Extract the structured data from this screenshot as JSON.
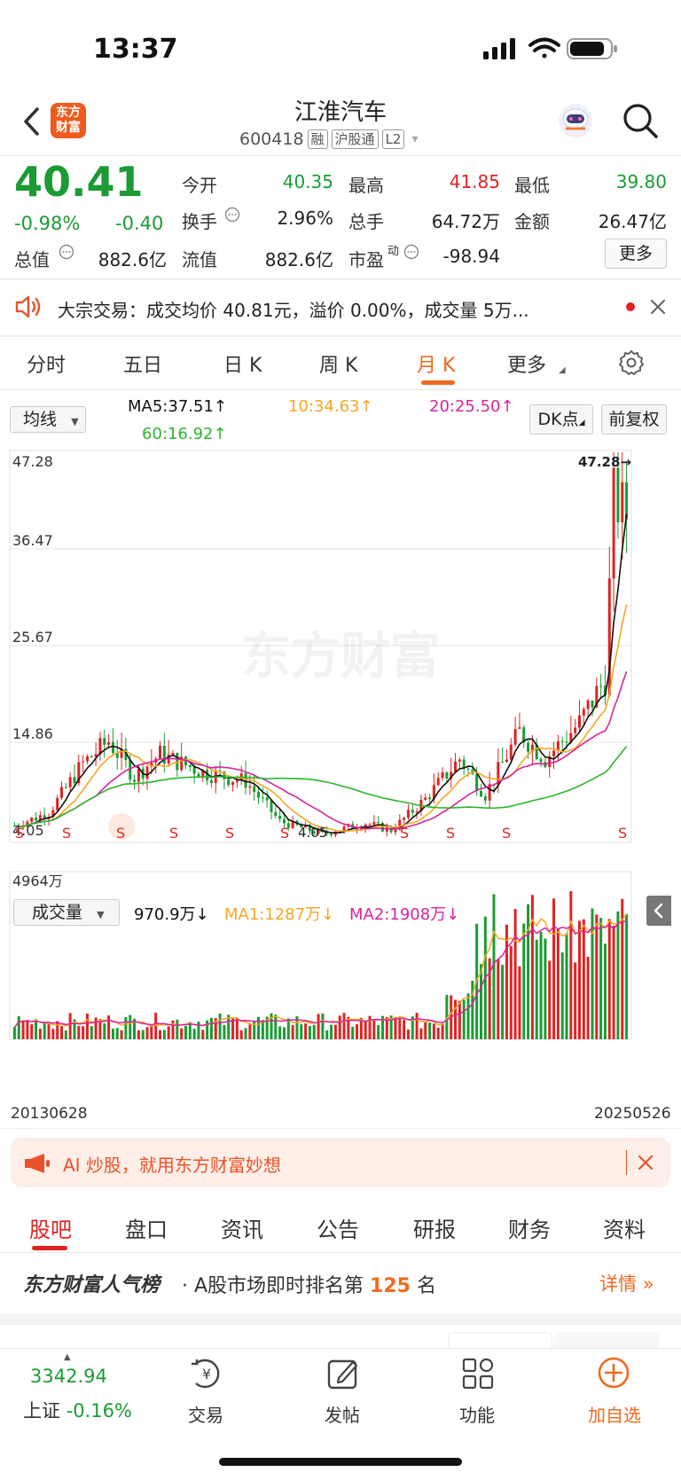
{
  "status_bar": {
    "time": "13:37"
  },
  "header": {
    "back_icon": "back-icon",
    "logo_line1": "东方",
    "logo_line2": "财富",
    "title": "江淮汽车",
    "code": "600418",
    "tags": [
      "融",
      "沪股通",
      "L2"
    ]
  },
  "quote": {
    "price": "40.41",
    "change_pct": "-0.98%",
    "change": "-0.40",
    "rows": [
      [
        {
          "label": "今开",
          "value": "40.35",
          "color": "green"
        },
        {
          "label": "最高",
          "value": "41.85",
          "color": "red"
        },
        {
          "label": "最低",
          "value": "39.80",
          "color": "green"
        }
      ],
      [
        {
          "label": "换手",
          "value": "2.96%",
          "color": "normal"
        },
        {
          "label": "总手",
          "value": "64.72万",
          "color": "normal"
        },
        {
          "label": "金额",
          "value": "26.47亿",
          "color": "normal"
        }
      ],
      [
        {
          "label": "总值",
          "value": "882.6亿",
          "color": "normal"
        },
        {
          "label": "流值",
          "value": "882.6亿",
          "color": "normal"
        },
        {
          "label": "市盈",
          "value": "-98.94",
          "color": "normal"
        }
      ]
    ],
    "pe_superscript": "动",
    "more_button": "更多"
  },
  "notice": {
    "text": "大宗交易：成交均价 40.81元，溢价 0.00%，成交量 5万..."
  },
  "period_tabs": [
    "分时",
    "五日",
    "日 K",
    "周 K",
    "月 K",
    "更多"
  ],
  "active_period": "月 K",
  "ma_legend": {
    "selector": "均线",
    "ma5": "MA5:37.51",
    "ma10": "10:34.63",
    "ma20": "20:25.50",
    "ma60": "60:16.92",
    "dk_button": "DK点",
    "adjust_button": "前复权"
  },
  "colors": {
    "up": "#e02222",
    "down": "#1a9b33",
    "ma5": "#111111",
    "ma10": "#f5a623",
    "ma20": "#d6249f",
    "ma60": "#2db52d",
    "accent": "#f06a1e"
  },
  "chart_data": {
    "type": "candlestick",
    "price_axis_labels": [
      "47.28",
      "36.47",
      "25.67",
      "14.86",
      "4.05"
    ],
    "price_max_label": "47.28→",
    "price_min_label": "4.05",
    "buy_sell_marks": [
      "S",
      "S",
      "S",
      "S",
      "S",
      "S",
      "S",
      "S",
      "S",
      "S",
      "S",
      "S"
    ],
    "watermark": "东方财富",
    "volume": {
      "selector": "成交量",
      "current": "970.9万↓",
      "ma1": "MA1:1287万↓",
      "ma2": "MA2:1908万↓",
      "max_label": "4964万"
    },
    "x_start": "20130628",
    "x_end": "20250526"
  },
  "ai_banner": {
    "text": "AI 炒股，就用东方财富妙想"
  },
  "bottom_tabs": [
    "股吧",
    "盘口",
    "资讯",
    "公告",
    "研报",
    "财务",
    "资料"
  ],
  "active_bottom_tab": "股吧",
  "rank": {
    "brand": "东方财富人气榜",
    "text_before": "· A股市场即时排名第",
    "rank_number": "125",
    "text_after": "名",
    "link": "详情"
  },
  "bottom_nav": {
    "index_value": "3342.94",
    "index_name": "上证",
    "index_change": "-0.16%",
    "items": [
      "交易",
      "发帖",
      "功能",
      "加自选"
    ]
  }
}
